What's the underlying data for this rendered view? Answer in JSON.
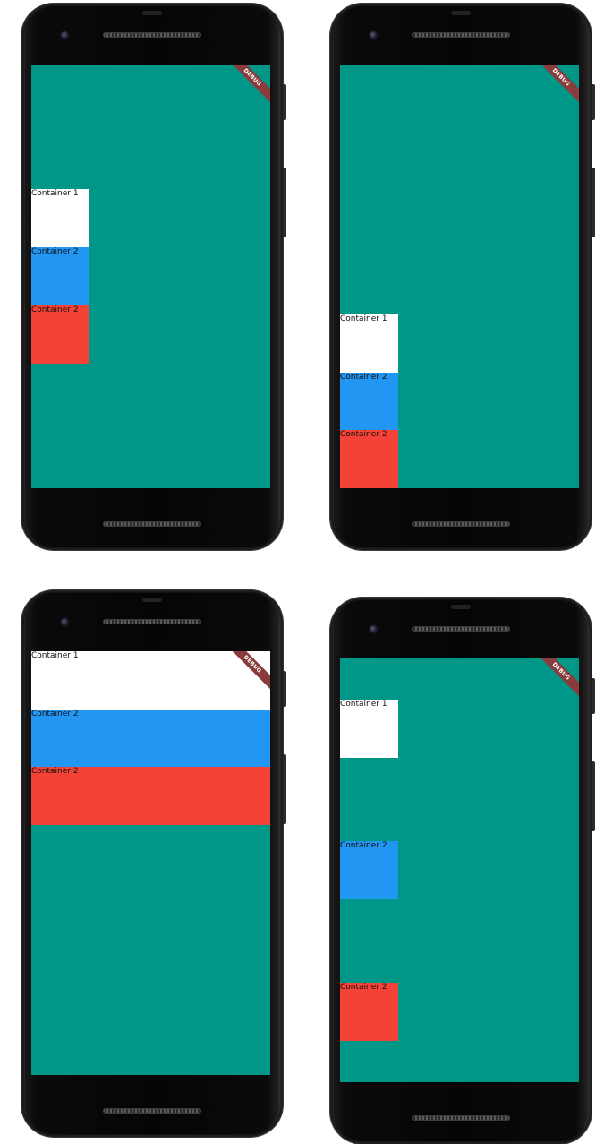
{
  "debug_banner": "DEBUG",
  "colors": {
    "screen_background": "#009688",
    "container_1": "#ffffff",
    "container_2_blue": "#2196f3",
    "container_2_red": "#f44336",
    "debug_banner": "#8a3b3b"
  },
  "phones": [
    {
      "layout": "vertical stack, center-start",
      "containers": [
        {
          "label": "Container 1",
          "color": "#ffffff"
        },
        {
          "label": "Container 2",
          "color": "#2196f3"
        },
        {
          "label": "Container 2",
          "color": "#f44336"
        }
      ]
    },
    {
      "layout": "vertical stack, end-start",
      "containers": [
        {
          "label": "Container 1",
          "color": "#ffffff"
        },
        {
          "label": "Container 2",
          "color": "#2196f3"
        },
        {
          "label": "Container 2",
          "color": "#f44336"
        }
      ]
    },
    {
      "layout": "vertical stack, start, stretched",
      "containers": [
        {
          "label": "Container 1",
          "color": "#ffffff"
        },
        {
          "label": "Container 2",
          "color": "#2196f3"
        },
        {
          "label": "Container 2",
          "color": "#f44336"
        }
      ]
    },
    {
      "layout": "vertical stack, space-evenly",
      "containers": [
        {
          "label": "Container 1",
          "color": "#ffffff"
        },
        {
          "label": "Container 2",
          "color": "#2196f3"
        },
        {
          "label": "Container 2",
          "color": "#f44336"
        }
      ]
    }
  ]
}
